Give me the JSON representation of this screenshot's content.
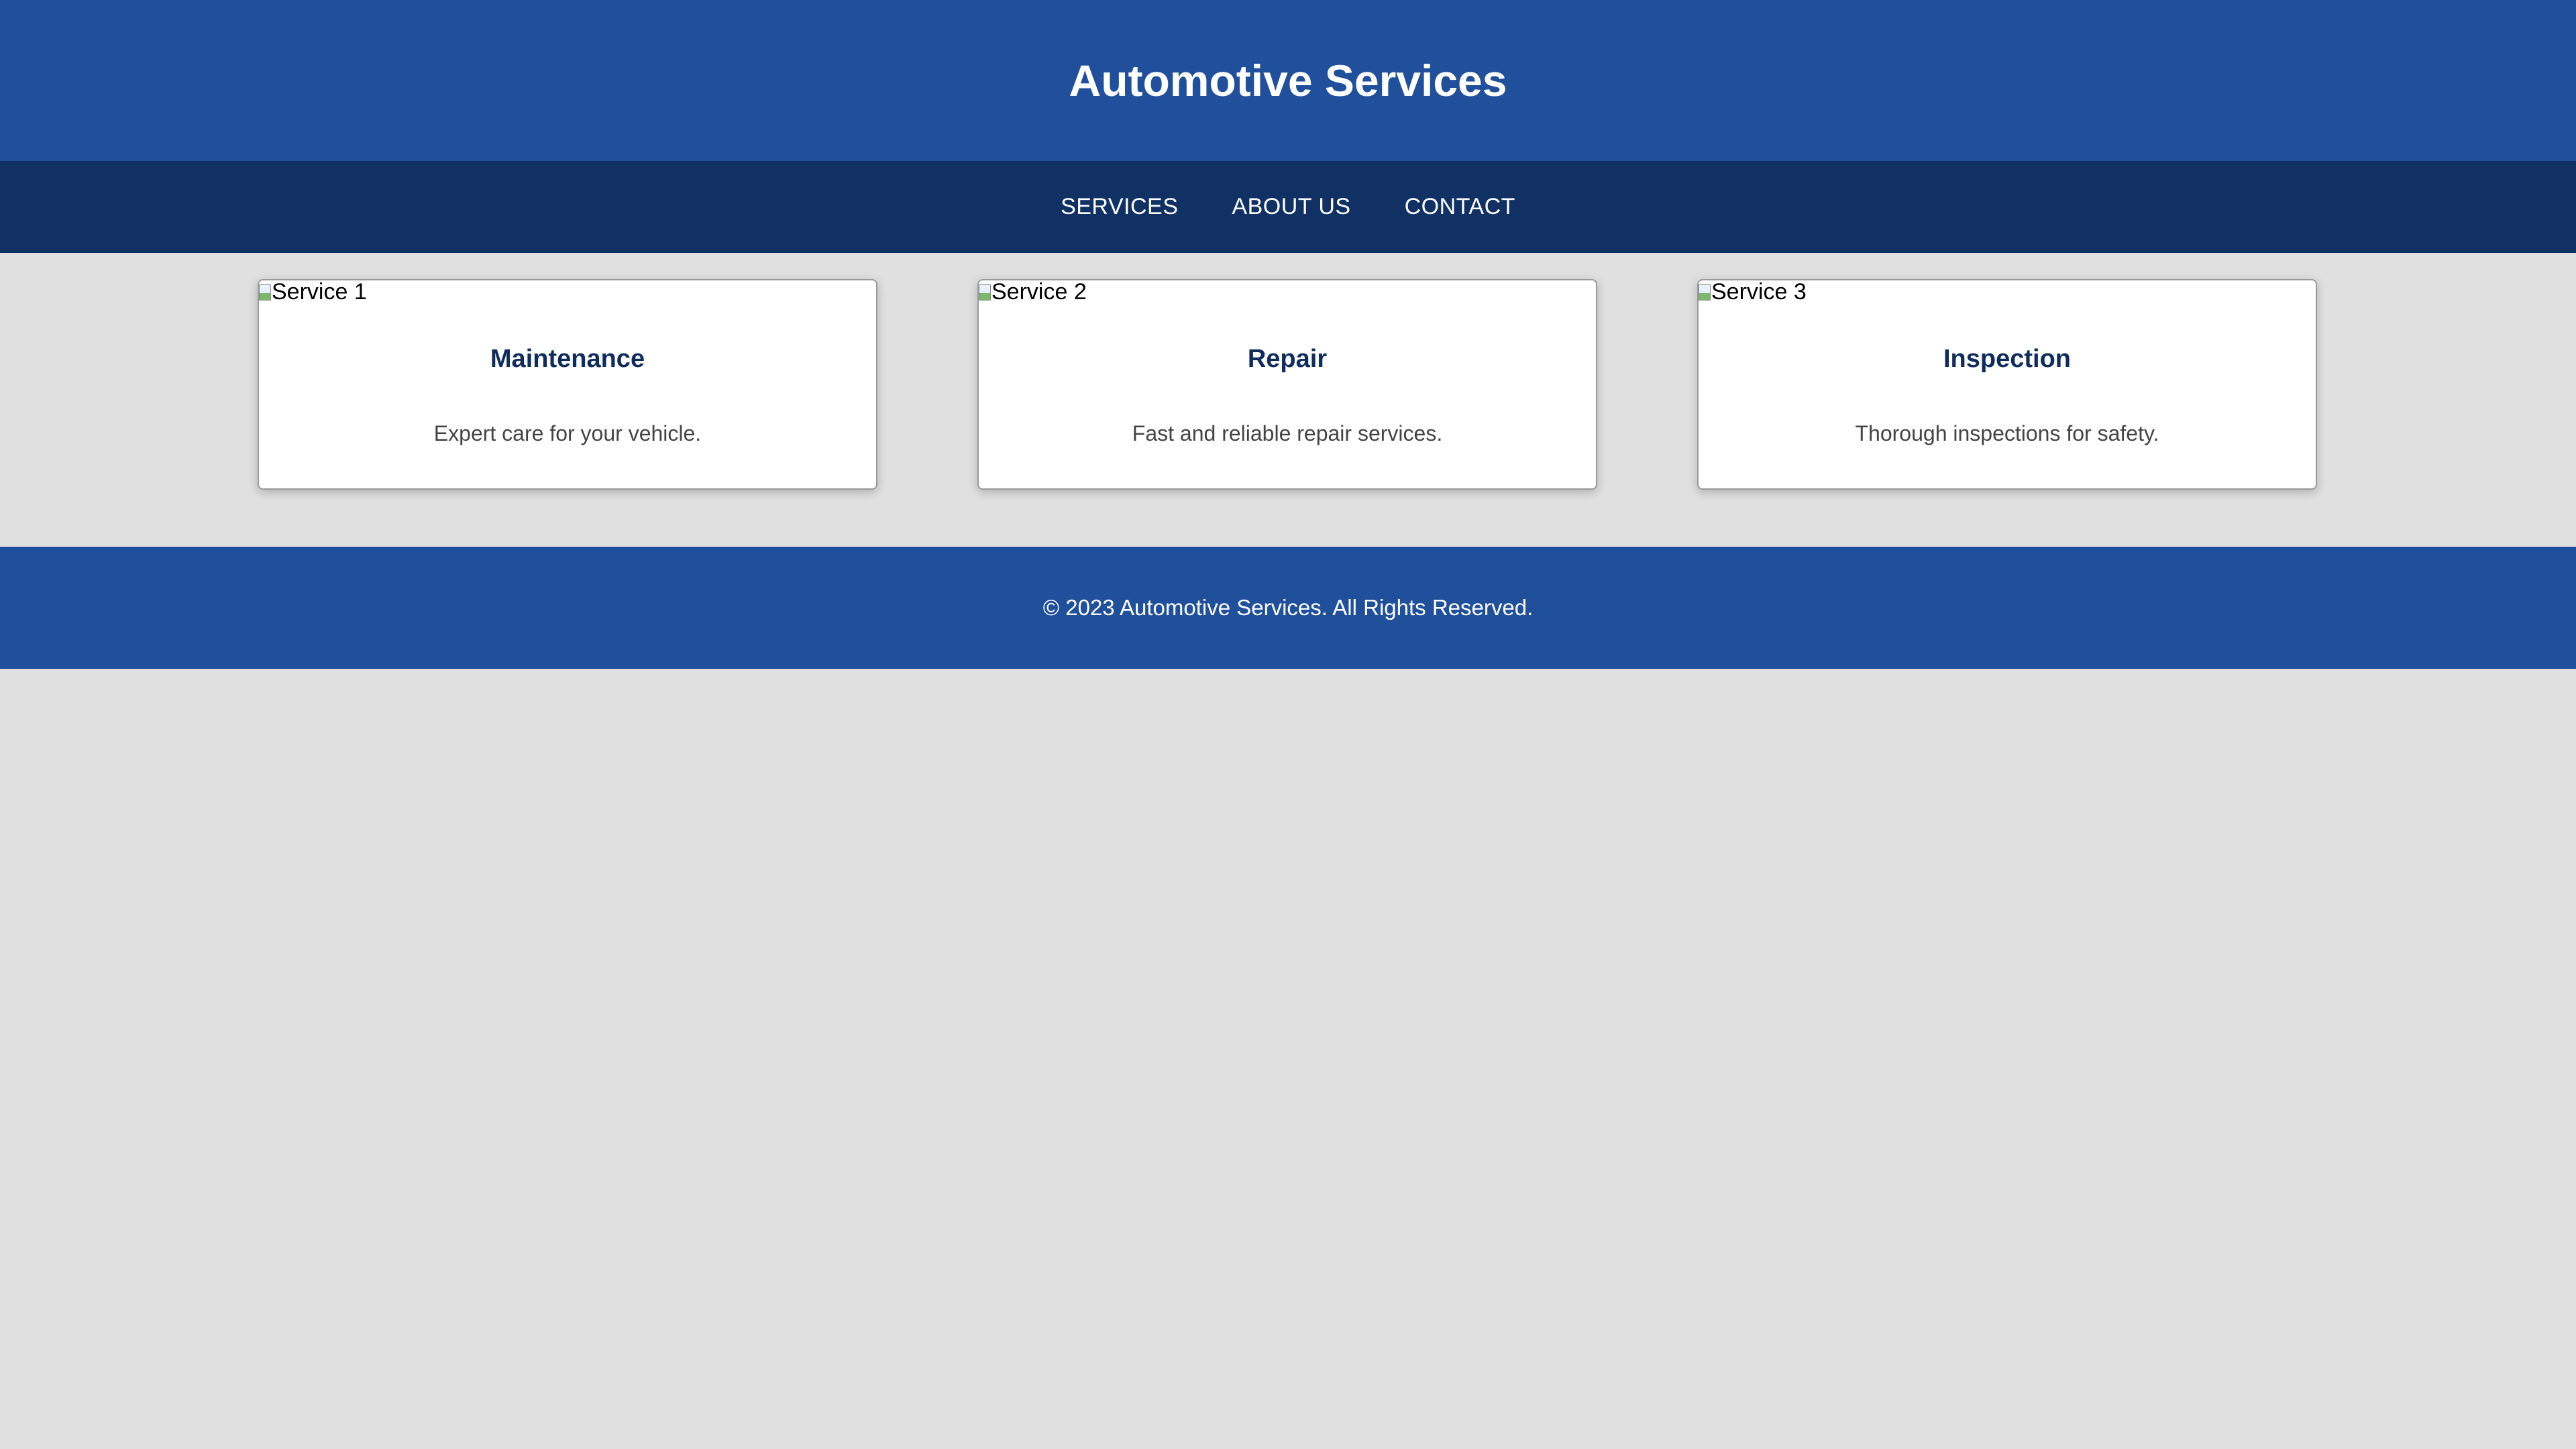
{
  "header": {
    "title": "Automotive Services"
  },
  "nav": {
    "items": [
      {
        "label": "SERVICES"
      },
      {
        "label": "ABOUT US"
      },
      {
        "label": "CONTACT"
      }
    ]
  },
  "services": [
    {
      "image_alt": "Service 1",
      "title": "Maintenance",
      "description": "Expert care for your vehicle."
    },
    {
      "image_alt": "Service 2",
      "title": "Repair",
      "description": "Fast and reliable repair services."
    },
    {
      "image_alt": "Service 3",
      "title": "Inspection",
      "description": "Thorough inspections for safety."
    }
  ],
  "footer": {
    "text": "© 2023 Automotive Services. All Rights Reserved."
  },
  "colors": {
    "header_bg": "#20509b",
    "nav_bg": "#113165",
    "page_bg": "#e0e0e0",
    "card_title": "#0f2c5c"
  },
  "icons": {
    "broken_image": "broken-image-icon"
  }
}
